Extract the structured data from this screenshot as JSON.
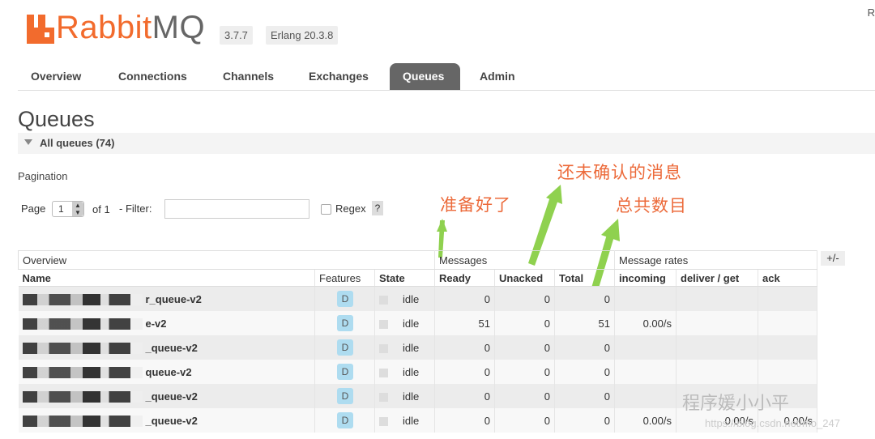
{
  "header": {
    "logo_text_rabbit": "Rabbit",
    "logo_text_mq": "MQ",
    "version": "3.7.7",
    "erlang": "Erlang 20.3.8",
    "corner": "R"
  },
  "nav": {
    "tabs": [
      "Overview",
      "Connections",
      "Channels",
      "Exchanges",
      "Queues",
      "Admin"
    ],
    "active": "Queues"
  },
  "page": {
    "title": "Queues",
    "section": "All queues (74)",
    "pagination_label": "Pagination",
    "page_label": "Page",
    "page_value": "1",
    "of_label": "of 1",
    "filter_label": "- Filter:",
    "filter_value": "",
    "regex_label": "Regex",
    "help": "?"
  },
  "annotations": {
    "ready": "准备好了",
    "unacked": "还未确认的消息",
    "total": "总共数目"
  },
  "table": {
    "groups": [
      "Overview",
      "Messages",
      "Message rates"
    ],
    "toggle": "+/-",
    "columns": [
      "Name",
      "Features",
      "State",
      "Ready",
      "Unacked",
      "Total",
      "incoming",
      "deliver / get",
      "ack"
    ],
    "rows": [
      {
        "name": "r_queue-v2",
        "feature": "D",
        "state": "idle",
        "ready": "0",
        "unacked": "0",
        "total": "0",
        "incoming": "",
        "deliver": "",
        "ack": ""
      },
      {
        "name": "e-v2",
        "feature": "D",
        "state": "idle",
        "ready": "51",
        "unacked": "0",
        "total": "51",
        "incoming": "0.00/s",
        "deliver": "",
        "ack": ""
      },
      {
        "name": "_queue-v2",
        "feature": "D",
        "state": "idle",
        "ready": "0",
        "unacked": "0",
        "total": "0",
        "incoming": "",
        "deliver": "",
        "ack": ""
      },
      {
        "name": "queue-v2",
        "feature": "D",
        "state": "idle",
        "ready": "0",
        "unacked": "0",
        "total": "0",
        "incoming": "",
        "deliver": "",
        "ack": ""
      },
      {
        "name": "_queue-v2",
        "feature": "D",
        "state": "idle",
        "ready": "0",
        "unacked": "0",
        "total": "0",
        "incoming": "",
        "deliver": "",
        "ack": ""
      },
      {
        "name": "_queue-v2",
        "feature": "D",
        "state": "idle",
        "ready": "0",
        "unacked": "0",
        "total": "0",
        "incoming": "0.00/s",
        "deliver": "0.00/s",
        "ack": "0.00/s"
      }
    ]
  },
  "watermark": {
    "text": "程序媛小小平",
    "url": "https://blog.csdn.net/mo_247"
  },
  "colors": {
    "brand": "#f26b2d",
    "annotation": "#ec6a3a",
    "arrow": "#8fd14f",
    "active_tab": "#666666"
  }
}
